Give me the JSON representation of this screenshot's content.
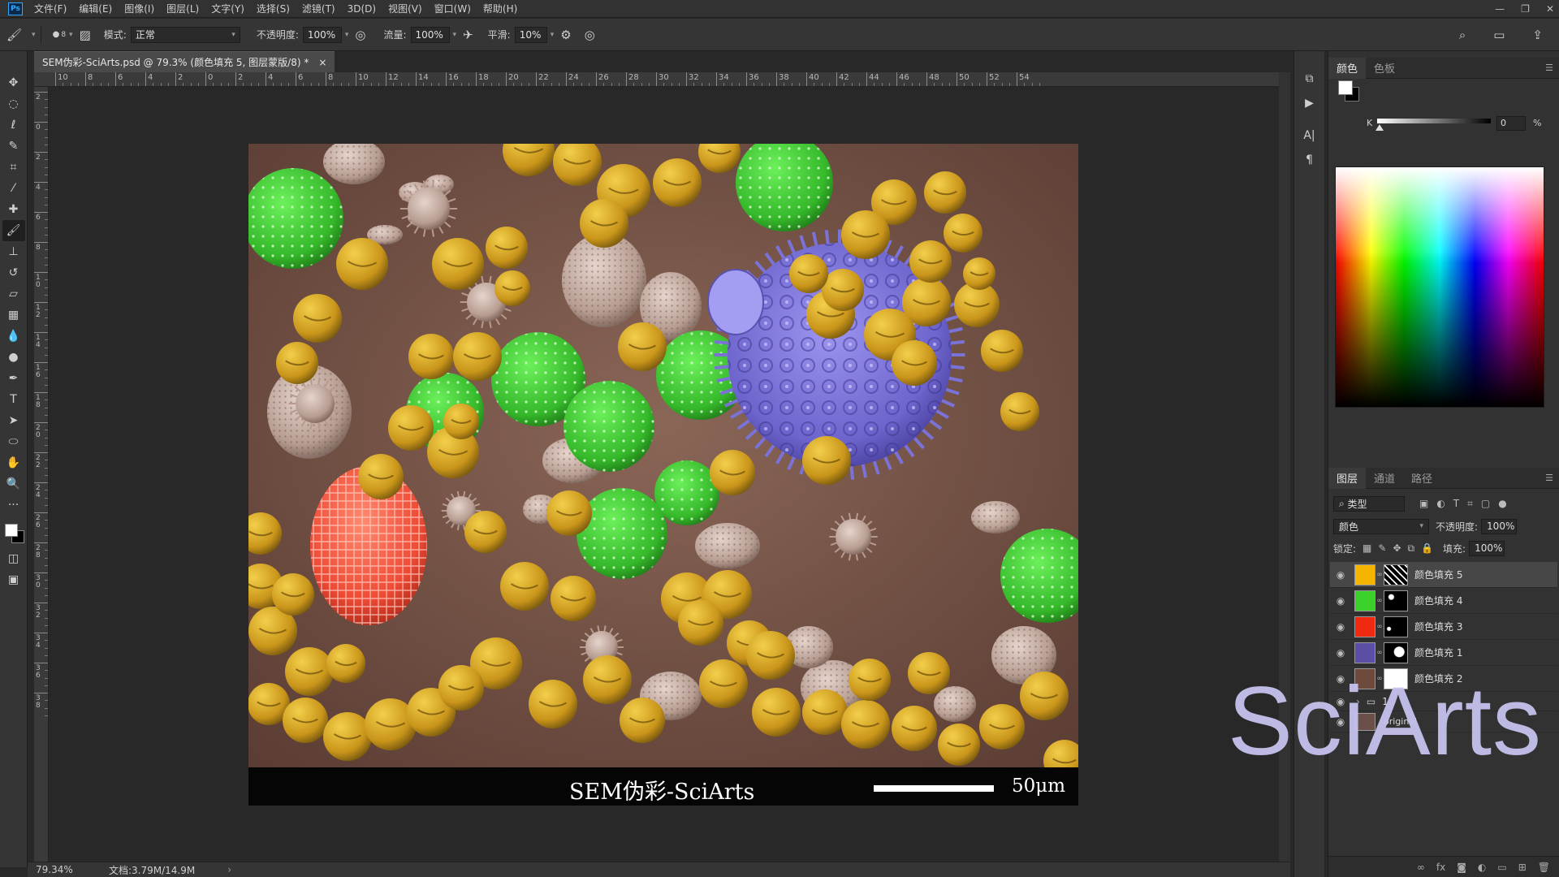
{
  "app": {
    "logo": "Ps",
    "menus": [
      "文件(F)",
      "编辑(E)",
      "图像(I)",
      "图层(L)",
      "文字(Y)",
      "选择(S)",
      "滤镜(T)",
      "3D(D)",
      "视图(V)",
      "窗口(W)",
      "帮助(H)"
    ]
  },
  "options": {
    "brush_size": "8",
    "mode_label": "模式:",
    "mode_value": "正常",
    "opacity_label": "不透明度:",
    "opacity_value": "100%",
    "flow_label": "流量:",
    "flow_value": "100%",
    "smooth_label": "平滑:",
    "smooth_value": "10%"
  },
  "document": {
    "tab_title": "SEM伪彩-SciArts.psd @ 79.3% (颜色填充 5, 图层蒙版/8) *",
    "caption": "SEM伪彩-SciArts",
    "scale_label": "50μm"
  },
  "ruler": {
    "top_labels": [
      "10",
      "8",
      "6",
      "4",
      "2",
      "0",
      "2",
      "4",
      "6",
      "8",
      "10",
      "12",
      "14",
      "16",
      "18",
      "20",
      "22",
      "24",
      "26",
      "28",
      "30",
      "32",
      "34",
      "36",
      "38",
      "40",
      "42",
      "44",
      "46",
      "48",
      "50",
      "52",
      "54"
    ],
    "left_labels": [
      "2",
      "0",
      "2",
      "4",
      "6",
      "8",
      "10",
      "12",
      "14",
      "16",
      "18",
      "20",
      "22",
      "24",
      "26",
      "28",
      "30",
      "32",
      "34",
      "36",
      "38"
    ]
  },
  "status": {
    "zoom": "79.34%",
    "doc_size": "文档:3.79M/14.9M"
  },
  "color_panel": {
    "tabs": [
      "颜色",
      "色板"
    ],
    "k_label": "K",
    "k_value": "0",
    "k_unit": "%"
  },
  "layers_panel": {
    "tabs": [
      "图层",
      "通道",
      "路径"
    ],
    "filter_label": "类型",
    "blend_mode": "颜色",
    "opacity_label": "不透明度:",
    "opacity_value": "100%",
    "lock_label": "锁定:",
    "fill_label": "填充:",
    "fill_value": "100%",
    "layers": [
      {
        "name": "颜色填充 5",
        "color": "#f4b400",
        "selected": true
      },
      {
        "name": "颜色填充 4",
        "color": "#3ad12a",
        "selected": false
      },
      {
        "name": "颜色填充 3",
        "color": "#f02a10",
        "selected": false
      },
      {
        "name": "颜色填充 1",
        "color": "#5a4fa5",
        "selected": false
      },
      {
        "name": "颜色填充 2",
        "color": "#6e4a3c",
        "selected": false
      },
      {
        "name": "1",
        "color": "",
        "selected": false
      },
      {
        "name": "original",
        "color": "",
        "selected": false
      }
    ]
  },
  "watermark": "SciArts",
  "colors": {
    "pollen_yellow": "#d9a81e",
    "pollen_green": "#46c532",
    "pollen_purple": "#7a72d6",
    "pollen_red": "#f05a44",
    "pollen_pink": "#c9b3aa",
    "background_brown": "#7e5a4d"
  }
}
